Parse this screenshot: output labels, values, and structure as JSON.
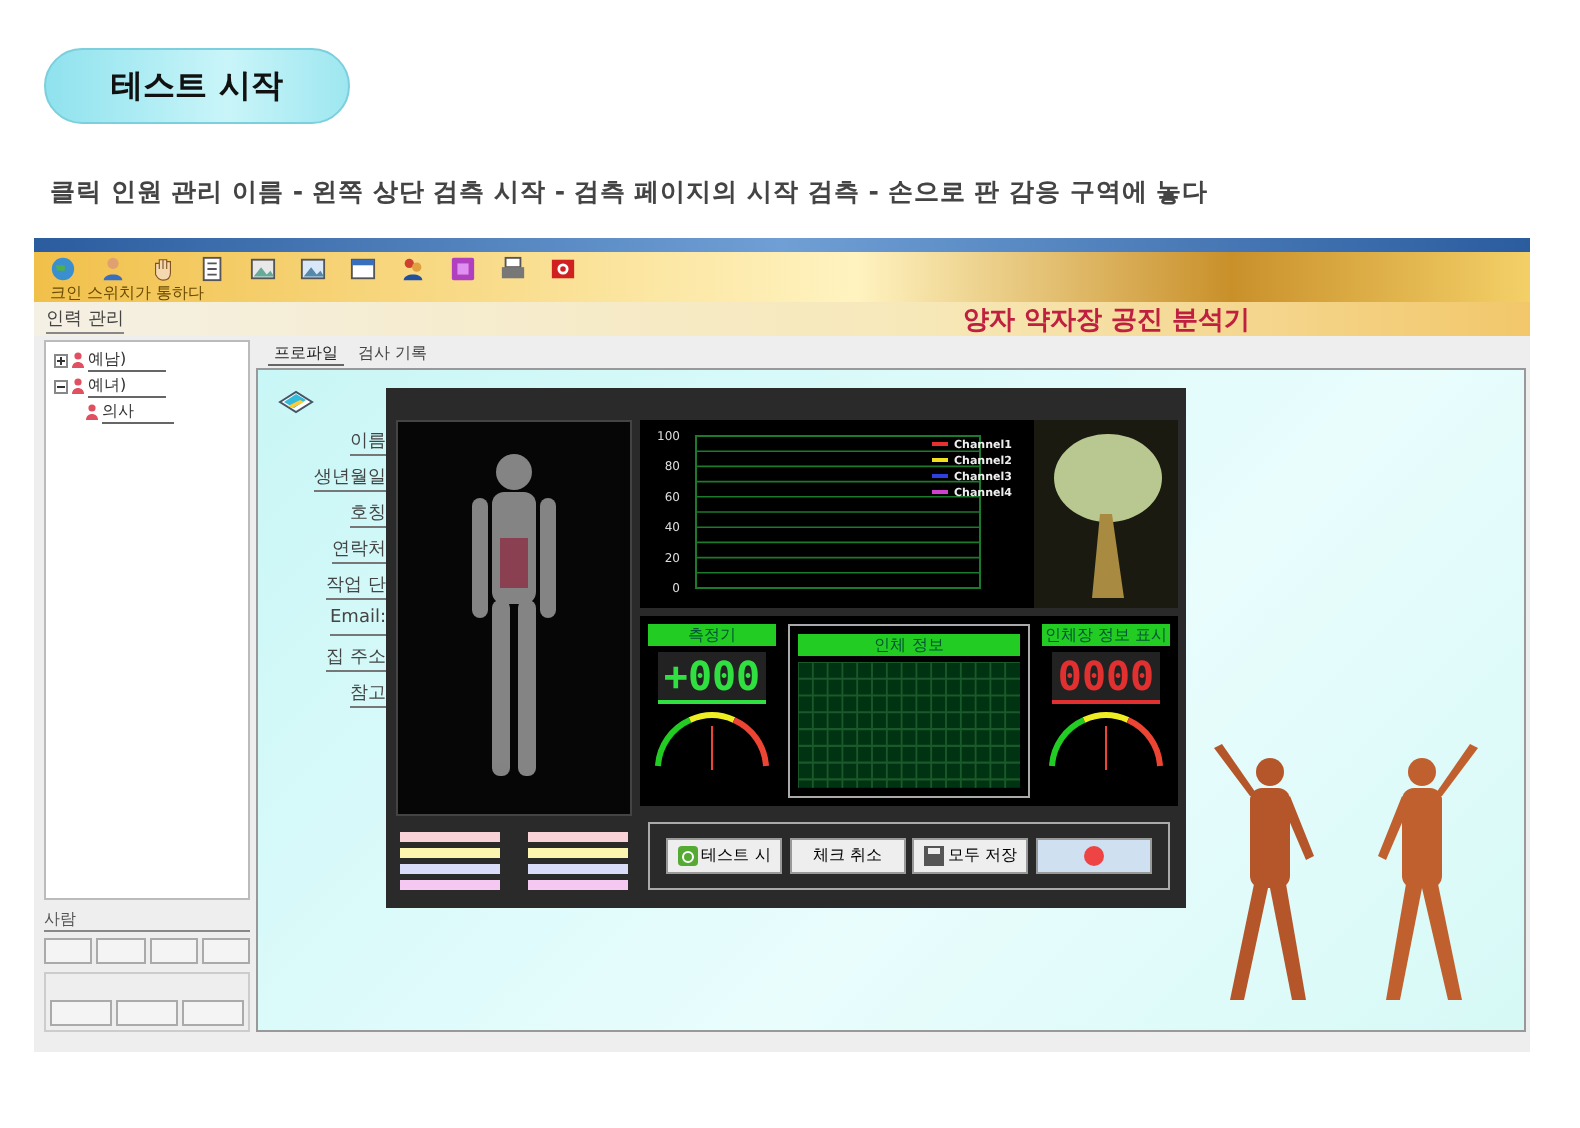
{
  "badge": {
    "label": "테스트 시작"
  },
  "instruction": "클릭 인원 관리 이름 - 왼쪽 상단 검측 시작 - 검측 페이지의 시작 검측 - 손으로 판 감응 구역에 놓다",
  "app": {
    "toolbar_caption": "크인 스위치가 통하다",
    "section_title": "인력 관리",
    "app_title": "양자 약자장 공진 분석기",
    "tree": [
      {
        "label": "예남)",
        "expanded": false
      },
      {
        "label": "예녀)",
        "expanded": true,
        "children": [
          {
            "label": "의사"
          }
        ]
      }
    ],
    "group_label": "사람",
    "tabs": [
      {
        "label": "프로파일",
        "selected": true
      },
      {
        "label": "검사 기록",
        "selected": false
      }
    ],
    "form_labels": [
      "이름",
      "생년월일",
      "호칭",
      "연락처",
      "작업 단",
      "Email:",
      "집 주소",
      "참고"
    ],
    "chart_data": {
      "type": "line",
      "grid": true,
      "ylim": [
        0,
        100
      ],
      "yticks": [
        0,
        20,
        40,
        60,
        80,
        100
      ],
      "series": [
        {
          "name": "Channel1",
          "color": "#e83030"
        },
        {
          "name": "Channel2",
          "color": "#f0e020"
        },
        {
          "name": "Channel3",
          "color": "#3040e0"
        },
        {
          "name": "Channel4",
          "color": "#d040d0"
        }
      ]
    },
    "meters": [
      {
        "title": "측정기",
        "reading": "+000",
        "color": "#30e040"
      },
      {
        "title": "인체장 정보 표시",
        "reading": "0000",
        "color": "#e03030"
      }
    ],
    "center_panel": {
      "title": "인체 정보"
    },
    "color_bars": [
      {
        "color": "#f9d2d8"
      },
      {
        "color": "#fbf5b0"
      },
      {
        "color": "#d8dcf8"
      },
      {
        "color": "#f4c8f0"
      }
    ],
    "buttons": [
      {
        "label": "테스트 시",
        "kind": "start"
      },
      {
        "label": "체크 취소",
        "kind": "plain"
      },
      {
        "label": "모두 저장",
        "kind": "save"
      },
      {
        "kind": "stop"
      }
    ]
  }
}
